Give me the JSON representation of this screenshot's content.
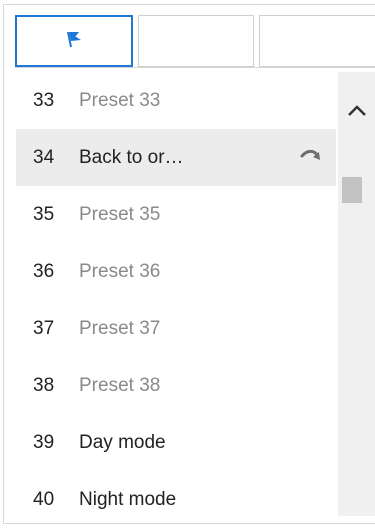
{
  "tabs": [
    {
      "name": "presets",
      "icon": "flag-icon",
      "active": true
    },
    {
      "name": "tab-2",
      "active": false
    },
    {
      "name": "tab-3",
      "active": false
    }
  ],
  "presets": [
    {
      "number": "33",
      "label": "Preset 33",
      "defined": false,
      "selected": false
    },
    {
      "number": "34",
      "label": "Back to or…",
      "defined": true,
      "selected": true
    },
    {
      "number": "35",
      "label": "Preset 35",
      "defined": false,
      "selected": false
    },
    {
      "number": "36",
      "label": "Preset 36",
      "defined": false,
      "selected": false
    },
    {
      "number": "37",
      "label": "Preset 37",
      "defined": false,
      "selected": false
    },
    {
      "number": "38",
      "label": "Preset 38",
      "defined": false,
      "selected": false
    },
    {
      "number": "39",
      "label": "Day mode",
      "defined": true,
      "selected": false
    },
    {
      "number": "40",
      "label": "Night mode",
      "defined": true,
      "selected": false
    }
  ],
  "selected_row_icon": "call-preset-arrow-icon",
  "scrollbar": {
    "up_icon": "chevron-up-icon"
  },
  "colors": {
    "accent": "#1f78d6",
    "selected_row": "#ececec",
    "text_defined": "#222222",
    "text_undefined": "#8a8a8a",
    "scroll_track": "#f0f0f0",
    "scroll_thumb": "#c2c2c2"
  }
}
